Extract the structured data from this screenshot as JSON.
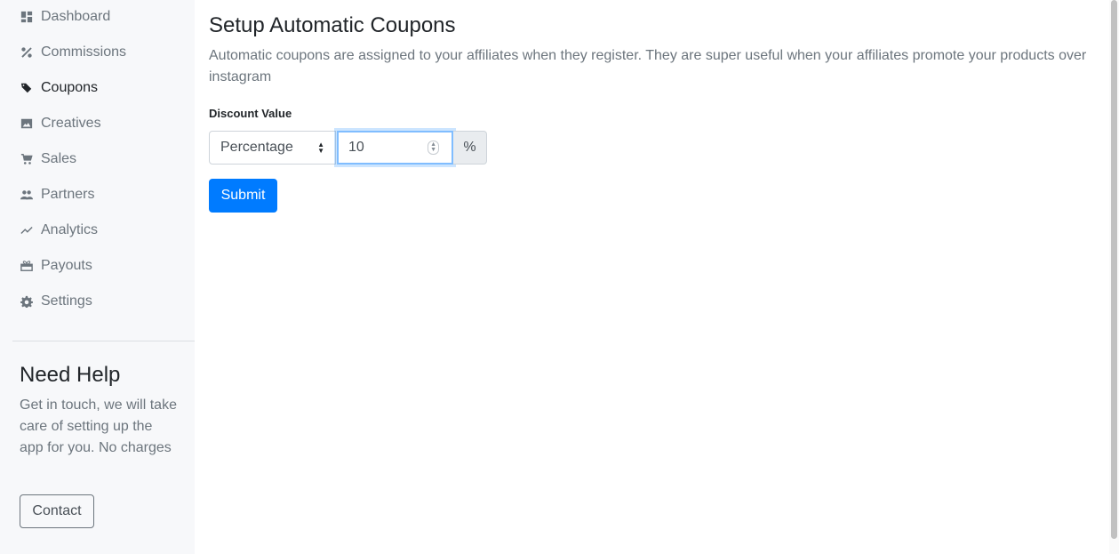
{
  "sidebar": {
    "items": [
      {
        "label": "Dashboard",
        "icon": "dashboard-icon",
        "active": false
      },
      {
        "label": "Commissions",
        "icon": "percent-icon",
        "active": false
      },
      {
        "label": "Coupons",
        "icon": "tags-icon",
        "active": true
      },
      {
        "label": "Creatives",
        "icon": "image-icon",
        "active": false
      },
      {
        "label": "Sales",
        "icon": "cart-icon",
        "active": false
      },
      {
        "label": "Partners",
        "icon": "people-icon",
        "active": false
      },
      {
        "label": "Analytics",
        "icon": "trending-icon",
        "active": false
      },
      {
        "label": "Payouts",
        "icon": "gift-icon",
        "active": false
      },
      {
        "label": "Settings",
        "icon": "gear-icon",
        "active": false
      }
    ],
    "help": {
      "title": "Need Help",
      "text": "Get in touch, we will take care of setting up the app for you. No charges",
      "contact_label": "Contact"
    }
  },
  "main": {
    "title": "Setup Automatic Coupons",
    "description": "Automatic coupons are assigned to your affiliates when they register. They are super useful when your affiliates promote your products over instagram",
    "discount": {
      "label": "Discount Value",
      "type_selected": "Percentage",
      "value": "10",
      "unit": "%"
    },
    "submit_label": "Submit"
  },
  "colors": {
    "primary": "#007bff",
    "sidebar_bg": "#f7f8fa",
    "muted_text": "#6c757d"
  }
}
